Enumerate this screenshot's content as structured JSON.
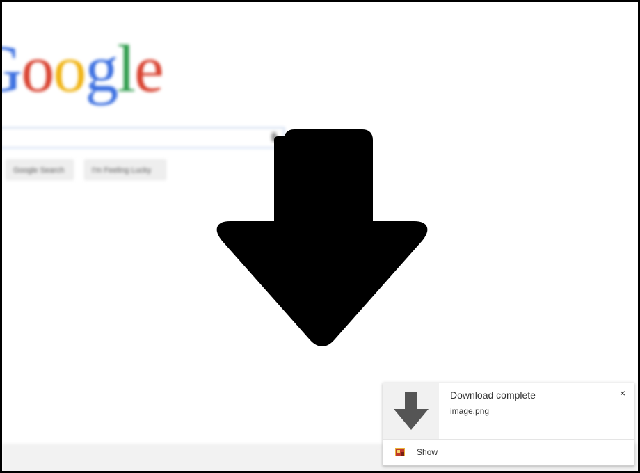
{
  "background_page": {
    "logo_letters": [
      {
        "char": "G",
        "color": "#3b6fe0"
      },
      {
        "char": "o",
        "color": "#d8412f"
      },
      {
        "char": "o",
        "color": "#f0b312"
      },
      {
        "char": "g",
        "color": "#3b6fe0"
      },
      {
        "char": "l",
        "color": "#2d9b4a"
      },
      {
        "char": "e",
        "color": "#d8412f"
      }
    ],
    "search_button_label": "Google Search",
    "lucky_button_label": "I'm Feeling Lucky"
  },
  "overlay": {
    "icon": "download-arrow-icon",
    "color": "#000000"
  },
  "notification": {
    "title": "Download complete",
    "filename": "image.png",
    "close_glyph": "×",
    "action_label": "Show",
    "icon": "download-arrow-icon",
    "icon_color": "#555555",
    "background": "#ffffff"
  }
}
